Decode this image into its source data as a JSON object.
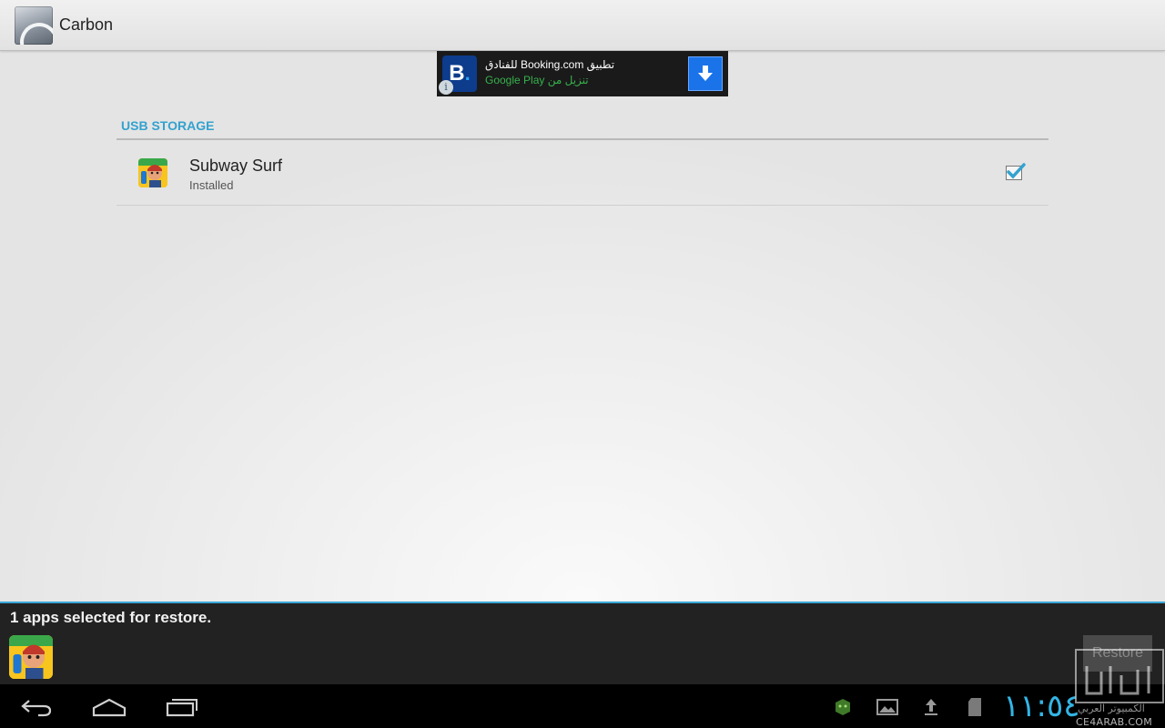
{
  "app": {
    "title": "Carbon",
    "icon": "carbon-app-icon"
  },
  "ad": {
    "brand_letter": "B",
    "line1": "تطبيق Booking.com للفنادق",
    "line2": "تنزيل من Google Play",
    "info_glyph": "i",
    "icons": [
      "booking-logo-icon",
      "info-icon",
      "download-arrow-icon"
    ]
  },
  "section": {
    "header": "USB STORAGE"
  },
  "apps": [
    {
      "name": "Subway Surf",
      "status": "Installed",
      "icon": "subway-surf-icon",
      "checked": true
    }
  ],
  "selection": {
    "summary": "1 apps selected for restore.",
    "restore_label": "Restore"
  },
  "navigation": {
    "buttons": [
      "back-icon",
      "home-icon",
      "recent-apps-icon"
    ]
  },
  "status_bar": {
    "clock": "١١:٥٤",
    "icons": [
      "android-debug-icon",
      "gallery-icon",
      "upload-icon",
      "sd-card-icon"
    ]
  },
  "watermark": {
    "text": "الكمبيوتر العربي",
    "url": "CE4ARAB.COM"
  },
  "colors": {
    "accent": "#33b5e5",
    "section_header": "#33a2cf",
    "ad_download": "#1a73e8"
  }
}
